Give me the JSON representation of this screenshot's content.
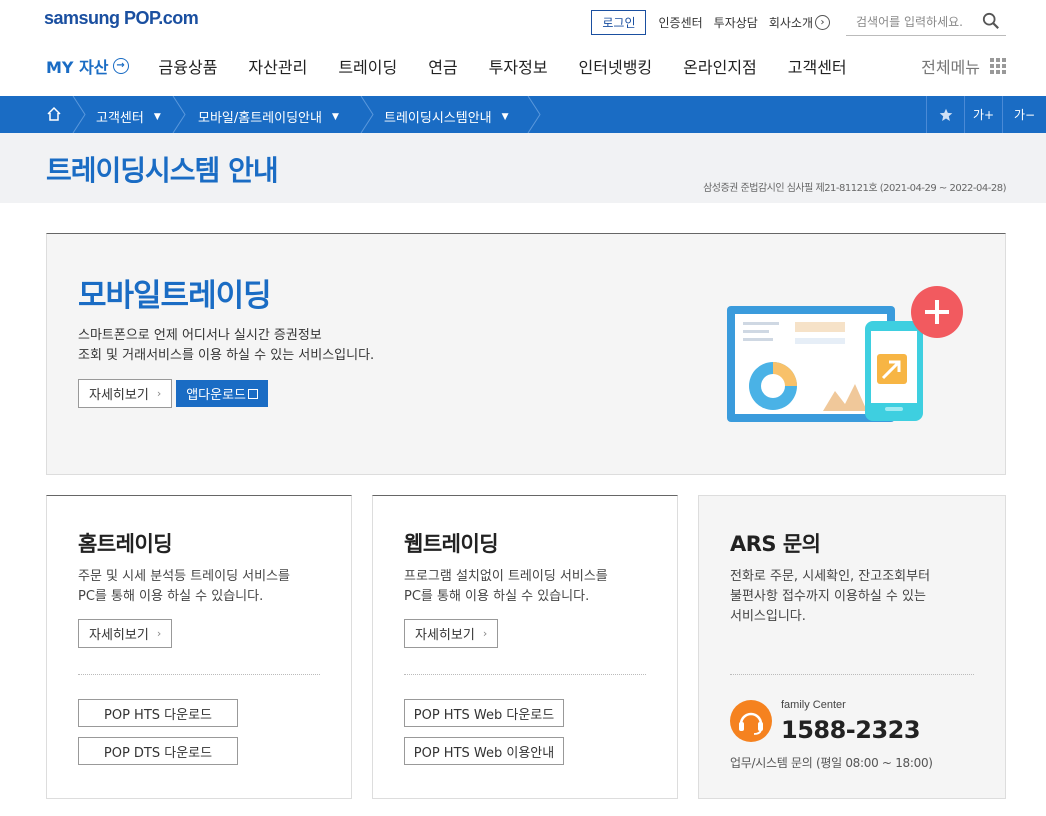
{
  "header": {
    "logo_prefix": "samsung ",
    "logo_brand": "POP",
    "logo_suffix": ".com",
    "login": "로그인",
    "links": [
      "인증센터",
      "투자상담",
      "회사소개"
    ],
    "search_placeholder": "검색어를 입력하세요."
  },
  "nav": {
    "my_asset": "MY 자산",
    "items": [
      "금융상품",
      "자산관리",
      "트레이딩",
      "연금",
      "투자정보",
      "인터넷뱅킹",
      "온라인지점",
      "고객센터"
    ],
    "all_menu": "전체메뉴"
  },
  "breadcrumb": {
    "items": [
      "고객센터",
      "모바일/홈트레이딩안내",
      "트레이딩시스템안내"
    ],
    "font_plus": "가+",
    "font_minus": "가−"
  },
  "page": {
    "title": "트레이딩시스템 안내",
    "note": "삼성증권 준법감시인 심사필 제21-81121호 (2021-04-29 ~ 2022-04-28)"
  },
  "mobile": {
    "title": "모바일트레이딩",
    "desc_line1": "스마트폰으로 언제 어디서나 실시간 증권정보",
    "desc_line2": "조회 및 거래서비스를 이용 하실 수 있는 서비스입니다.",
    "detail_button": "자세히보기",
    "app_download": "앱다운로드"
  },
  "home": {
    "title": "홈트레이딩",
    "desc_line1": "주문 및 시세 분석등 트레이딩 서비스를",
    "desc_line2": "PC를 통해 이용 하실 수 있습니다.",
    "detail_button": "자세히보기",
    "download1": "POP HTS 다운로드",
    "download2": "POP DTS 다운로드"
  },
  "web": {
    "title": "웹트레이딩",
    "desc_line1": "프로그램 설치없이 트레이딩 서비스를",
    "desc_line2": "PC를 통해 이용 하실 수 있습니다.",
    "detail_button": "자세히보기",
    "download1": "POP HTS Web 다운로드",
    "download2": "POP HTS Web 이용안내"
  },
  "ars": {
    "title": "ARS 문의",
    "desc_line1": "전화로 주문, 시세확인, 잔고조회부터",
    "desc_line2": "불편사항 접수까지 이용하실 수 있는",
    "desc_line3": "서비스입니다.",
    "center_label": "family Center",
    "phone": "1588-2323",
    "hours": "업무/시스템 문의 (평일 08:00 ~ 18:00)"
  },
  "colors": {
    "primary": "#1a6cc4",
    "orange": "#f5821f"
  }
}
